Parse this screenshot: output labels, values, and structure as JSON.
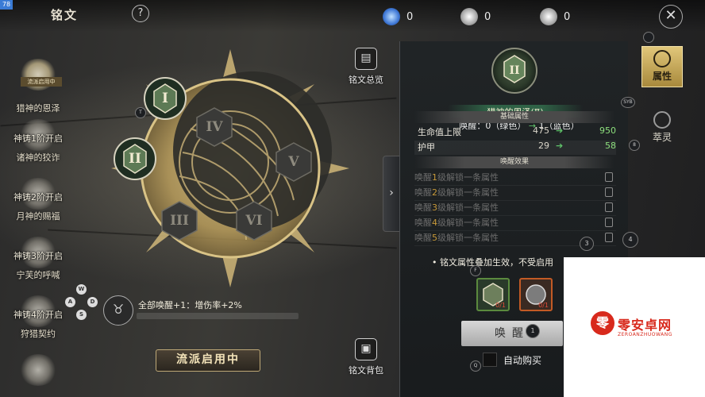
{
  "header": {
    "title": "铭文",
    "help_label": "?",
    "corner_badge": "78",
    "close_label": "✕"
  },
  "currencies": [
    {
      "icon": "blue-crystal-icon",
      "value": "0",
      "color": "#6fa8ff"
    },
    {
      "icon": "silver-gem-icon",
      "value": "0",
      "color": "#d9d9d9"
    },
    {
      "icon": "silver-gem-icon",
      "value": "0",
      "color": "#d9d9d9"
    }
  ],
  "sidebar": {
    "active_tag": "流派启用中",
    "items": [
      {
        "caption": "",
        "name": "猎神的恩泽",
        "selected": true
      },
      {
        "caption": "神铸1阶开启",
        "name": "诸神的狡诈"
      },
      {
        "caption": "神铸2阶开启",
        "name": "月神的赐福"
      },
      {
        "caption": "神铸3阶开启",
        "name": "宁芙的呼喊"
      },
      {
        "caption": "神铸4阶开启",
        "name": "狩猎契约"
      }
    ]
  },
  "rune_slots": [
    {
      "label": "I",
      "state": "active"
    },
    {
      "label": "II",
      "state": "active"
    },
    {
      "label": "IV",
      "state": "locked"
    },
    {
      "label": "V",
      "state": "locked"
    },
    {
      "label": "III",
      "state": "locked"
    },
    {
      "label": "VI",
      "state": "locked"
    }
  ],
  "controller": {
    "keys": [
      "W",
      "A",
      "D",
      "S"
    ],
    "target_badge": "T"
  },
  "bonus": {
    "text": "全部唤醒+1：增伤率+2%"
  },
  "route_button": "流派启用中",
  "nav": {
    "overview": "铭文总览",
    "bag": "铭文背包"
  },
  "panel": {
    "name": "猎神的恩泽(Ⅱ)",
    "emblem_label": "II",
    "awaken_prefix": "唤醒：",
    "awaken_from": "0（绿色）",
    "awaken_arrow": "→",
    "awaken_to": "1（蓝色）",
    "base_header": "基础属性",
    "stats": [
      {
        "name": "生命值上限",
        "from": "475",
        "to": "950"
      },
      {
        "name": "护甲",
        "from": "29",
        "to": "58"
      }
    ],
    "effect_header": "唤醒效果",
    "locked_effects": [
      {
        "pre": "唤醒",
        "num": "1",
        "post": "级解锁一条属性"
      },
      {
        "pre": "唤醒",
        "num": "2",
        "post": "级解锁一条属性"
      },
      {
        "pre": "唤醒",
        "num": "3",
        "post": "级解锁一条属性"
      },
      {
        "pre": "唤醒",
        "num": "4",
        "post": "级解锁一条属性"
      },
      {
        "pre": "唤醒",
        "num": "5",
        "post": "级解锁一条属性"
      }
    ],
    "note": "• 铭文属性叠加生效，不受启用",
    "materials": [
      {
        "icon": "rune-material-icon",
        "count": "0/1",
        "border": "#5b8a3e"
      },
      {
        "icon": "relic-material-icon",
        "count": "0/1",
        "border": "#c25a25"
      }
    ],
    "awaken_button": "唤醒",
    "auto_buy": "自动购买"
  },
  "right_tabs": [
    {
      "label": "属性",
      "active": true
    },
    {
      "label": "萃灵",
      "active": false
    }
  ],
  "hints": [
    "SYB",
    "8",
    "3",
    "4",
    "F",
    "1",
    "Q"
  ],
  "watermark": {
    "name": "零安卓网",
    "sub": "ZEROANZHUOWANG",
    "logo": "零"
  },
  "colors": {
    "accent_gold": "#e1c77a",
    "up_green": "#5fc36a",
    "panel_bg": "#202426"
  }
}
